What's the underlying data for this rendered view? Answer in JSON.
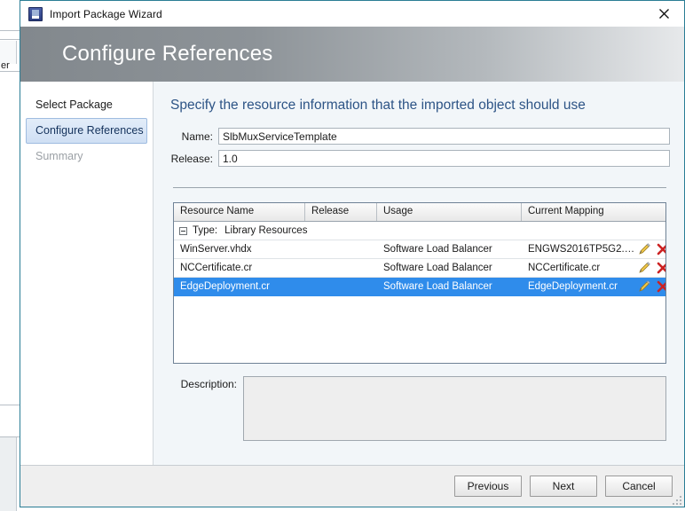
{
  "window": {
    "title": "Import Package Wizard",
    "icon": "package-icon",
    "close_label": "✕"
  },
  "banner": {
    "title": "Configure References"
  },
  "sidebar": {
    "items": [
      {
        "label": "Select Package",
        "state": "normal"
      },
      {
        "label": "Configure References",
        "state": "selected"
      },
      {
        "label": "Summary",
        "state": "disabled"
      }
    ]
  },
  "content": {
    "heading": "Specify the resource information that the imported object should use",
    "fields": [
      {
        "label": "Name:",
        "value": "SlbMuxServiceTemplate",
        "placeholder": ""
      },
      {
        "label": "Release:",
        "value": "1.0",
        "placeholder": ""
      }
    ],
    "description": {
      "label": "Description:",
      "value": "",
      "placeholder": ""
    }
  },
  "table": {
    "columns": [
      "Resource Name",
      "Release",
      "Usage",
      "Current Mapping"
    ],
    "group": {
      "label": "Type:",
      "value": "Library Resources",
      "expanded": true
    },
    "rows": [
      {
        "resource_name": "WinServer.vhdx",
        "release": "",
        "usage": "Software Load Balancer",
        "current_mapping": "ENGWS2016TP5G2.v...",
        "selected": false
      },
      {
        "resource_name": "NCCertificate.cr",
        "release": "",
        "usage": "Software Load Balancer",
        "current_mapping": "NCCertificate.cr",
        "selected": false
      },
      {
        "resource_name": "EdgeDeployment.cr",
        "release": "",
        "usage": "Software Load Balancer",
        "current_mapping": "EdgeDeployment.cr",
        "selected": true
      }
    ],
    "row_actions": {
      "edit": "edit-pencil-icon",
      "remove": "remove-x-icon"
    }
  },
  "footer": {
    "buttons": [
      {
        "label": "Previous"
      },
      {
        "label": "Next"
      },
      {
        "label": "Cancel"
      }
    ]
  },
  "background": {
    "fragment_text": "er"
  },
  "colors": {
    "dialog_border": "#2a7d95",
    "heading": "#2d5486",
    "selection": "#2f8ceb",
    "nav_selected_border": "#9fbce0",
    "remove_icon": "#cc2222",
    "edit_icon": "#e8b230"
  }
}
